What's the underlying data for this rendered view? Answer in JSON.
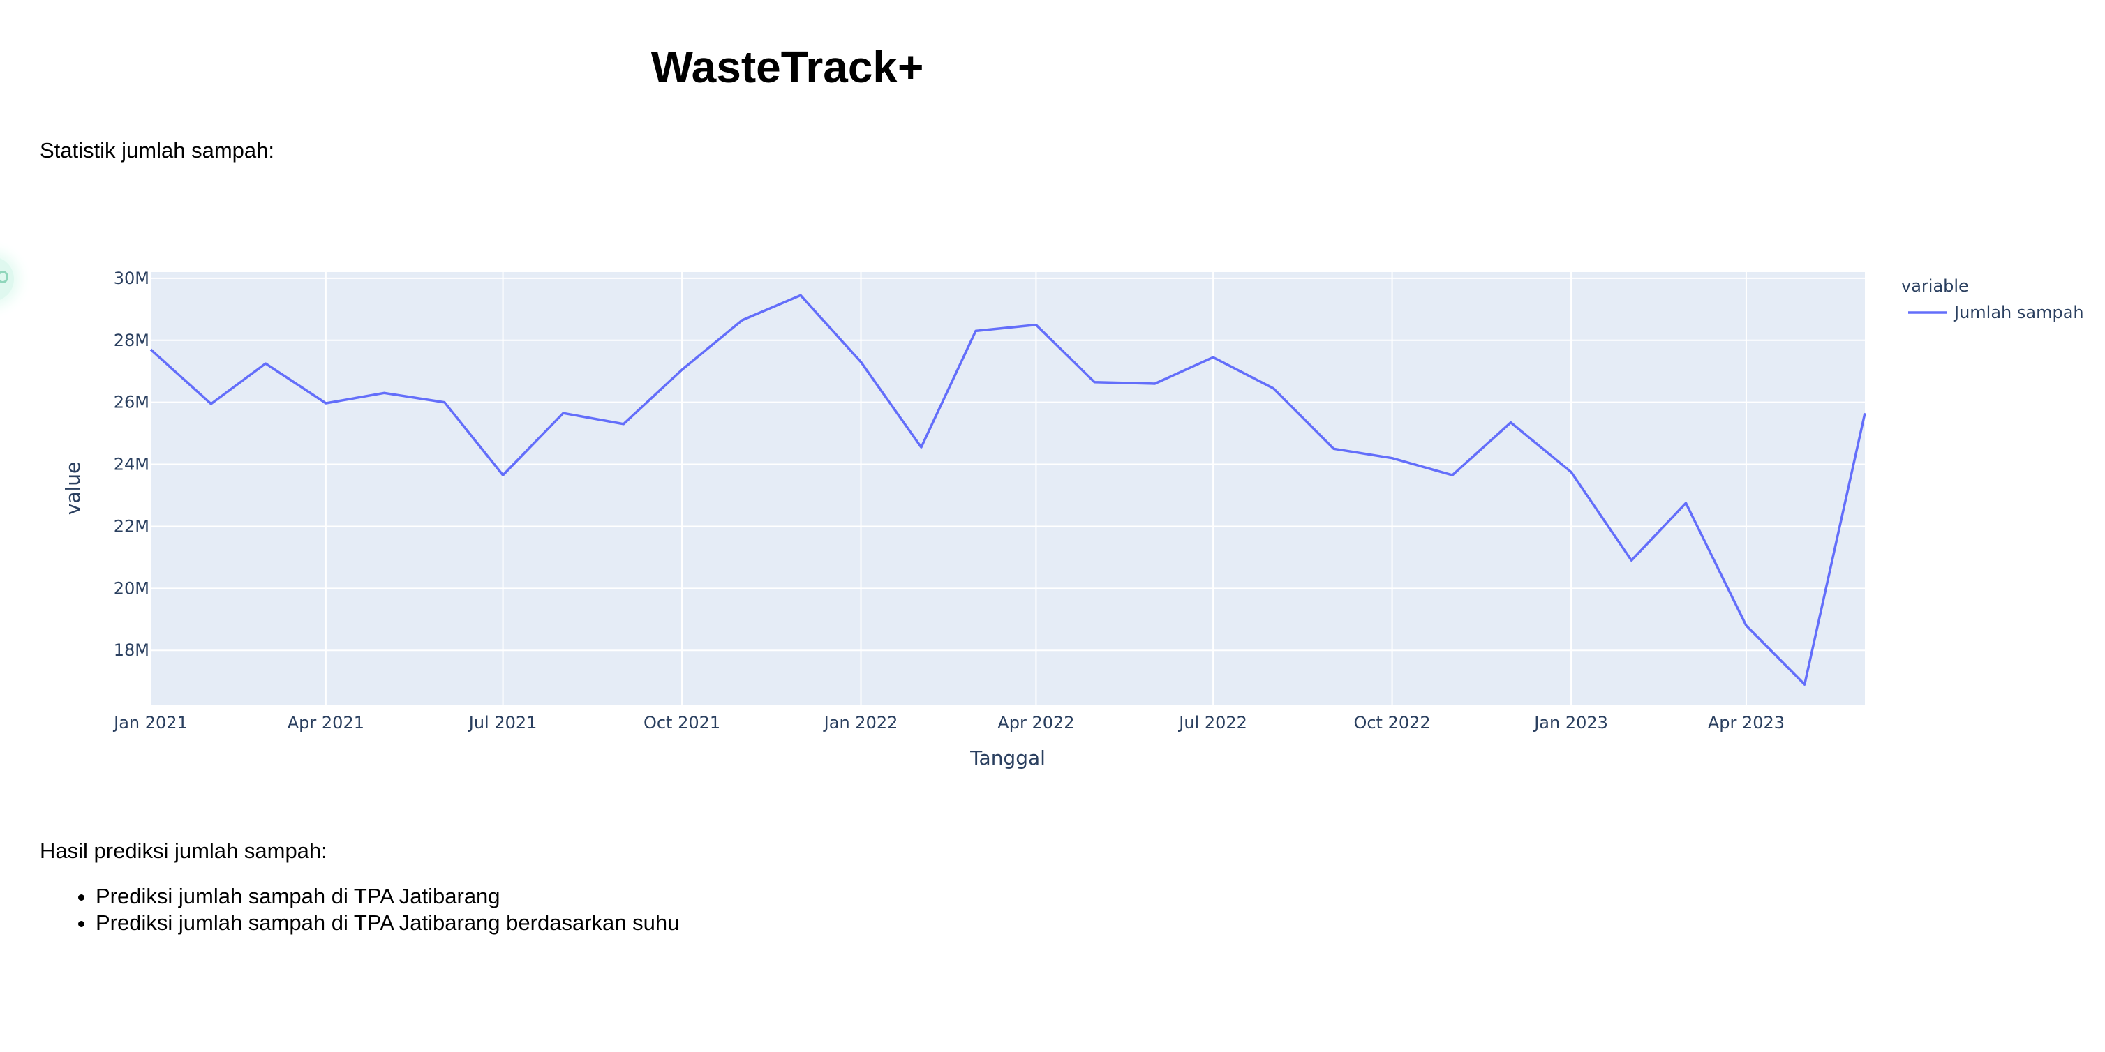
{
  "header": {
    "title": "WasteTrack+"
  },
  "sections": {
    "stat_label": "Statistik jumlah sampah:",
    "pred_label": "Hasil prediksi jumlah sampah:",
    "pred_items": [
      "Prediksi jumlah sampah di TPA Jatibarang",
      "Prediksi jumlah sampah di TPA Jatibarang berdasarkan suhu"
    ]
  },
  "chart_data": {
    "type": "line",
    "title": "",
    "xlabel": "Tanggal",
    "ylabel": "value",
    "x_tick_labels": [
      "Jan 2021",
      "Apr 2021",
      "Jul 2021",
      "Oct 2021",
      "Jan 2022",
      "Apr 2022",
      "Jul 2022",
      "Oct 2022",
      "Jan 2023",
      "Apr 2023"
    ],
    "y_tick_labels": [
      "18M",
      "20M",
      "22M",
      "24M",
      "26M",
      "28M",
      "30M"
    ],
    "y_tick_values": [
      18000000,
      20000000,
      22000000,
      24000000,
      26000000,
      28000000,
      30000000
    ],
    "ylim": [
      16250000,
      30200000
    ],
    "xlim": [
      "2021-01-01",
      "2023-06-01"
    ],
    "grid": true,
    "legend_title": "variable",
    "legend_position": "top-right",
    "series": [
      {
        "name": "Jumlah sampah",
        "color": "#636efa",
        "x": [
          "2021-01-01",
          "2021-02-01",
          "2021-03-01",
          "2021-04-01",
          "2021-05-01",
          "2021-06-01",
          "2021-07-01",
          "2021-08-01",
          "2021-09-01",
          "2021-10-01",
          "2021-11-01",
          "2021-12-01",
          "2022-01-01",
          "2022-02-01",
          "2022-03-01",
          "2022-04-01",
          "2022-05-01",
          "2022-06-01",
          "2022-07-01",
          "2022-08-01",
          "2022-09-01",
          "2022-10-01",
          "2022-11-01",
          "2022-12-01",
          "2023-01-01",
          "2023-02-01",
          "2023-03-01",
          "2023-04-01",
          "2023-05-01",
          "2023-06-01"
        ],
        "values": [
          27700000,
          25950000,
          27250000,
          25970000,
          26300000,
          26000000,
          23650000,
          25650000,
          25300000,
          27050000,
          28650000,
          29450000,
          27300000,
          24550000,
          28300000,
          28500000,
          26650000,
          26600000,
          27450000,
          26450000,
          24500000,
          24200000,
          23650000,
          25350000,
          23750000,
          20900000,
          22750000,
          18800000,
          16900000,
          25650000
        ]
      }
    ]
  }
}
